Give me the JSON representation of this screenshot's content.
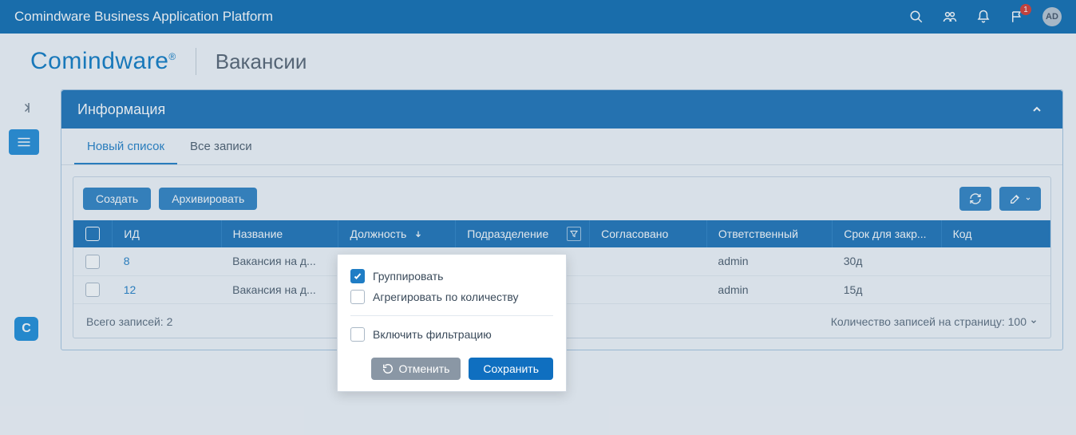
{
  "topbar": {
    "title": "Comindware Business Application Platform",
    "notif_count": "1",
    "avatar_initials": "AD"
  },
  "header": {
    "logo_text": "Comindware",
    "page_title": "Вакансии"
  },
  "panel": {
    "title": "Информация"
  },
  "tabs": {
    "t1": "Новый список",
    "t2": "Все записи"
  },
  "toolbar": {
    "create": "Создать",
    "archive": "Архивировать"
  },
  "columns": {
    "c1": "ИД",
    "c2": "Название",
    "c3": "Должность",
    "c4": "Подразделение",
    "c5": "Согласовано",
    "c6": "Ответственный",
    "c7": "Срок для закр...",
    "c8": "Код"
  },
  "rows": [
    {
      "id": "8",
      "title": "Вакансия на д...",
      "position": "",
      "department": "",
      "approved": "",
      "owner": "admin",
      "deadline": "30д",
      "code": ""
    },
    {
      "id": "12",
      "title": "Вакансия на д...",
      "position": "",
      "department": "",
      "approved": "",
      "owner": "admin",
      "deadline": "15д",
      "code": ""
    }
  ],
  "footer": {
    "total_label": "Всего записей: 2",
    "page_size_label": "Количество записей на страницу: 100"
  },
  "popup": {
    "opt_group": "Группировать",
    "opt_aggregate": "Агрегировать по количеству",
    "opt_filter": "Включить фильтрацию",
    "cancel": "Отменить",
    "save": "Сохранить"
  }
}
